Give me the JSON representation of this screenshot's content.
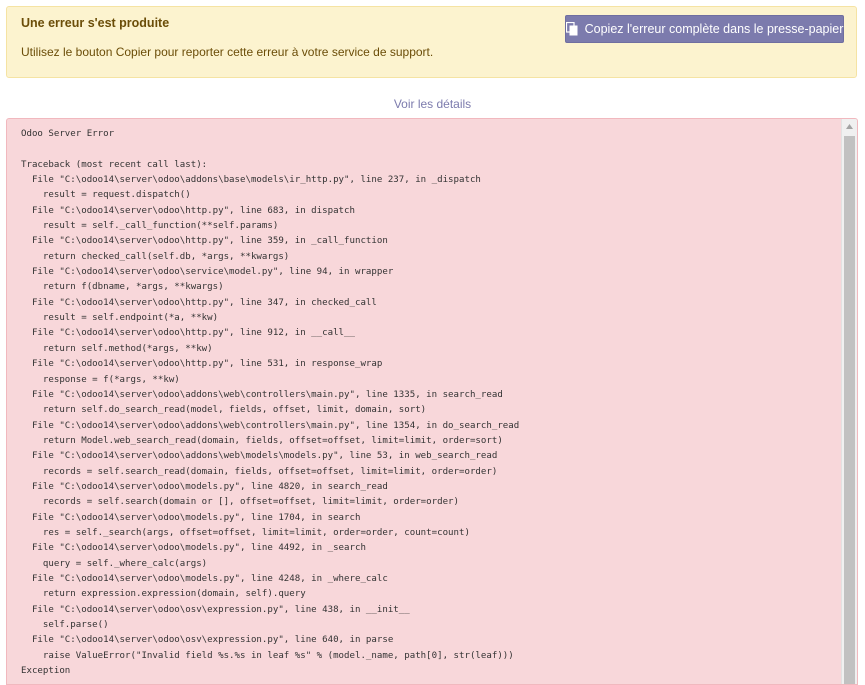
{
  "alert": {
    "title": "Une erreur s'est produite",
    "message": "Utilisez le bouton Copier pour reporter cette erreur à votre service de support.",
    "copy_button_label": "Copiez l'erreur complète dans le presse-papier",
    "copy_icon": "clipboard-icon"
  },
  "details_link": "Voir les détails",
  "traceback": {
    "lines": [
      "Odoo Server Error",
      "",
      "Traceback (most recent call last):",
      "  File \"C:\\odoo14\\server\\odoo\\addons\\base\\models\\ir_http.py\", line 237, in _dispatch",
      "    result = request.dispatch()",
      "  File \"C:\\odoo14\\server\\odoo\\http.py\", line 683, in dispatch",
      "    result = self._call_function(**self.params)",
      "  File \"C:\\odoo14\\server\\odoo\\http.py\", line 359, in _call_function",
      "    return checked_call(self.db, *args, **kwargs)",
      "  File \"C:\\odoo14\\server\\odoo\\service\\model.py\", line 94, in wrapper",
      "    return f(dbname, *args, **kwargs)",
      "  File \"C:\\odoo14\\server\\odoo\\http.py\", line 347, in checked_call",
      "    result = self.endpoint(*a, **kw)",
      "  File \"C:\\odoo14\\server\\odoo\\http.py\", line 912, in __call__",
      "    return self.method(*args, **kw)",
      "  File \"C:\\odoo14\\server\\odoo\\http.py\", line 531, in response_wrap",
      "    response = f(*args, **kw)",
      "  File \"C:\\odoo14\\server\\odoo\\addons\\web\\controllers\\main.py\", line 1335, in search_read",
      "    return self.do_search_read(model, fields, offset, limit, domain, sort)",
      "  File \"C:\\odoo14\\server\\odoo\\addons\\web\\controllers\\main.py\", line 1354, in do_search_read",
      "    return Model.web_search_read(domain, fields, offset=offset, limit=limit, order=sort)",
      "  File \"C:\\odoo14\\server\\odoo\\addons\\web\\models\\models.py\", line 53, in web_search_read",
      "    records = self.search_read(domain, fields, offset=offset, limit=limit, order=order)",
      "  File \"C:\\odoo14\\server\\odoo\\models.py\", line 4820, in search_read",
      "    records = self.search(domain or [], offset=offset, limit=limit, order=order)",
      "  File \"C:\\odoo14\\server\\odoo\\models.py\", line 1704, in search",
      "    res = self._search(args, offset=offset, limit=limit, order=order, count=count)",
      "  File \"C:\\odoo14\\server\\odoo\\models.py\", line 4492, in _search",
      "    query = self._where_calc(args)",
      "  File \"C:\\odoo14\\server\\odoo\\models.py\", line 4248, in _where_calc",
      "    return expression.expression(domain, self).query",
      "  File \"C:\\odoo14\\server\\odoo\\osv\\expression.py\", line 438, in __init__",
      "    self.parse()",
      "  File \"C:\\odoo14\\server\\odoo\\osv\\expression.py\", line 640, in parse",
      "    raise ValueError(\"Invalid field %s.%s in leaf %s\" % (model._name, path[0], str(leaf)))",
      "Exception"
    ]
  },
  "colors": {
    "alert_bg": "#fcf3cf",
    "alert_text": "#6b4d08",
    "button_bg": "#7c7bad",
    "link": "#7c7bad",
    "error_bg": "#f8d7da"
  }
}
